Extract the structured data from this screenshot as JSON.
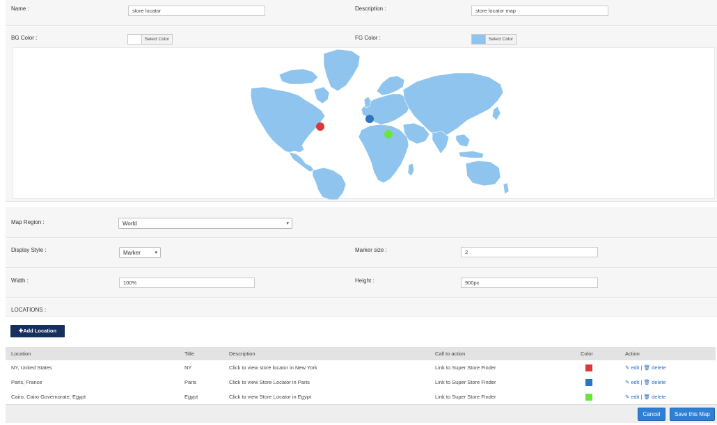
{
  "form": {
    "name_label": "Name :",
    "name_value": "store locator",
    "description_label": "Description :",
    "description_value": "store locator map",
    "bg_color_label": "BG Color :",
    "fg_color_label": "FG Color :",
    "select_color_label": "Select Color",
    "bg_color": "#ffffff",
    "fg_color": "#8fc4ee",
    "map_region_label": "Map Region :",
    "map_region_value": "World",
    "display_style_label": "Display Style :",
    "display_style_value": "Marker",
    "marker_size_label": "Marker size :",
    "marker_size_value": "2",
    "width_label": "Width :",
    "width_value": "100%",
    "height_label": "Height :",
    "height_value": "900px",
    "locations_label": "LOCATIONS :"
  },
  "map": {
    "land_color": "#8fc4ee",
    "markers": [
      {
        "location": "NY, United States",
        "color": "#d9393b"
      },
      {
        "location": "Paris, France",
        "color": "#2f74c0"
      },
      {
        "location": "Cairo, Cairo Governorate, Egypt",
        "color": "#6be53a"
      }
    ]
  },
  "add_location_label": "Add Location",
  "table": {
    "headers": [
      "Location",
      "Title",
      "Description",
      "Call to action",
      "Color",
      "Action"
    ],
    "rows": [
      {
        "location": "NY, United States",
        "title": "NY",
        "description": "Click to view store locator in New York",
        "cta": "Link to Super Store Finder",
        "color": "#d9393b"
      },
      {
        "location": "Paris, France",
        "title": "Paris",
        "description": "Click to view Store Locator in Paris",
        "cta": "Link to Super Store Finder",
        "color": "#2f74c0"
      },
      {
        "location": "Cairo, Cairo Governorate, Egypt",
        "title": "Egypt",
        "description": "Click to view Store Locator in Egypt",
        "cta": "Link to Super Store Finder",
        "color": "#6be53a"
      }
    ],
    "edit_label": "edit",
    "delete_label": "delete",
    "separator": "|"
  },
  "footer": {
    "cancel_label": "Cancel",
    "save_label": "Save this Map"
  }
}
